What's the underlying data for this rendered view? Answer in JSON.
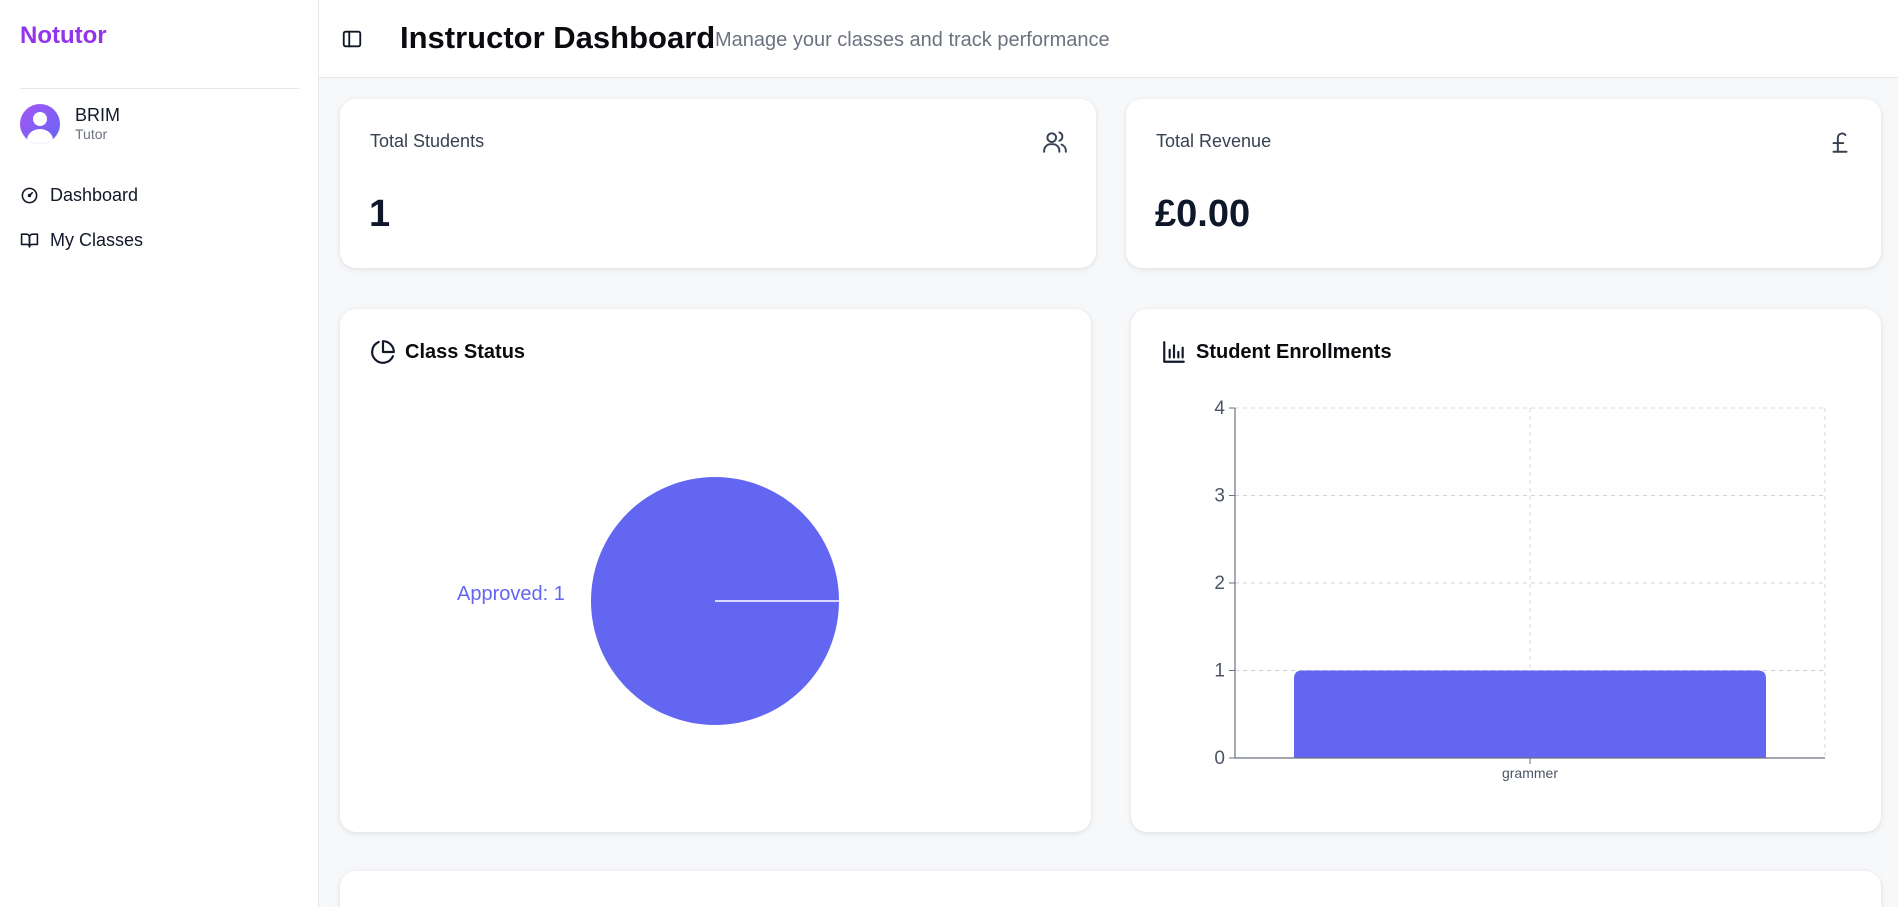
{
  "sidebar": {
    "brand": "Notutor",
    "user": {
      "name": "BRIM",
      "role": "Tutor"
    },
    "items": [
      {
        "label": "Dashboard",
        "icon": "dashboard-icon"
      },
      {
        "label": "My Classes",
        "icon": "book-open-icon"
      }
    ]
  },
  "header": {
    "title": "Instructor Dashboard",
    "subtitle": "Manage your classes and track performance"
  },
  "stats": {
    "students": {
      "label": "Total Students",
      "value": "1",
      "icon": "users-icon"
    },
    "revenue": {
      "label": "Total Revenue",
      "value": "£0.00",
      "icon": "pound-icon"
    }
  },
  "class_status": {
    "title": "Class Status",
    "icon": "pie-chart-icon",
    "slice_label": "Approved: 1"
  },
  "enrollments": {
    "title": "Student Enrollments",
    "icon": "bar-chart-icon"
  },
  "colors": {
    "brand": "#9333ea",
    "accent": "#6366f1"
  },
  "chart_data": [
    {
      "type": "pie",
      "title": "Class Status",
      "slices": [
        {
          "name": "Approved",
          "value": 1,
          "color": "#6366f1"
        }
      ]
    },
    {
      "type": "bar",
      "title": "Student Enrollments",
      "categories": [
        "grammer"
      ],
      "values": [
        1
      ],
      "ylim": [
        0,
        4
      ],
      "yticks": [
        0,
        1,
        2,
        3,
        4
      ],
      "grid": true,
      "grid_style": "dashed",
      "color": "#6366f1"
    }
  ]
}
